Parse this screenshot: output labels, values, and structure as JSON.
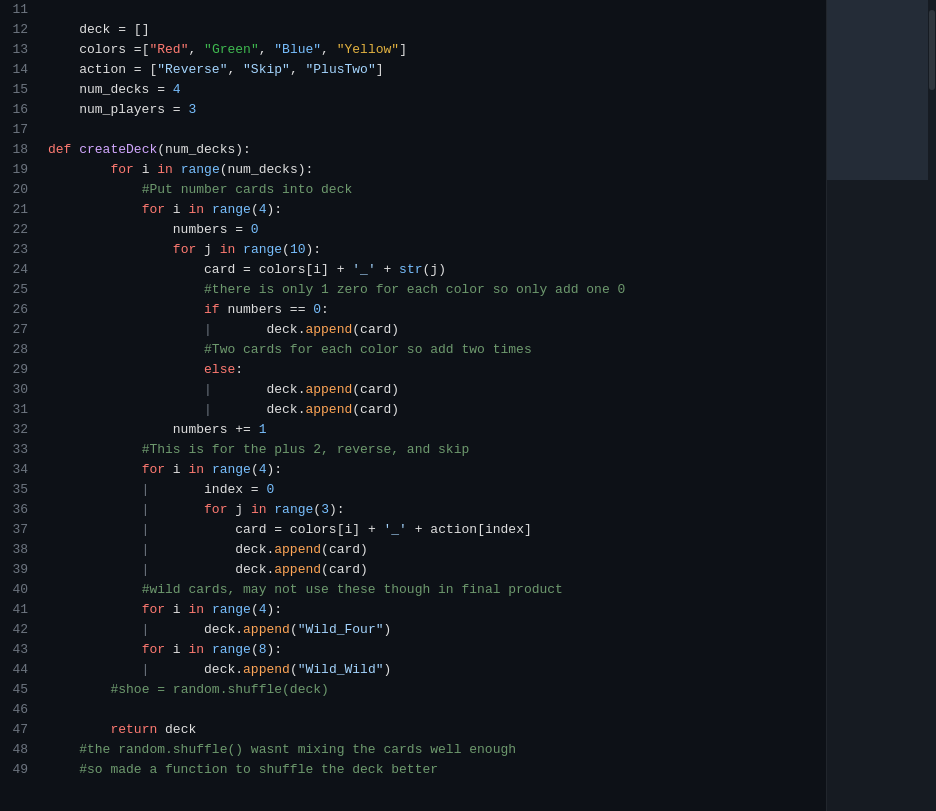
{
  "lines": [
    {
      "num": "11",
      "tokens": []
    },
    {
      "num": "12",
      "html": "<span class='va'>    deck</span><span class='op'> = </span><span class='bracket'>[]</span>"
    },
    {
      "num": "13",
      "html": "<span class='va'>    colors </span><span class='op'>=</span><span class='bracket'>[</span><span class='str-red'>\"Red\"</span><span class='op'>, </span><span class='str-green'>\"Green\"</span><span class='op'>, </span><span class='str-blue'>\"Blue\"</span><span class='op'>, </span><span class='str-yellow'>\"Yellow\"</span><span class='bracket'>]</span>"
    },
    {
      "num": "14",
      "html": "<span class='va'>    action</span><span class='op'> = </span><span class='bracket'>[</span><span class='st'>\"Reverse\"</span><span class='op'>, </span><span class='st'>\"Skip\"</span><span class='op'>, </span><span class='st'>\"PlusTwo\"</span><span class='bracket'>]</span>"
    },
    {
      "num": "15",
      "html": "<span class='va'>    num_decks</span><span class='op'> = </span><span class='nm'>4</span>"
    },
    {
      "num": "16",
      "html": "<span class='va'>    num_players</span><span class='op'> = </span><span class='nm'>3</span>"
    },
    {
      "num": "17",
      "html": ""
    },
    {
      "num": "18",
      "html": "<span class='kw'>def </span><span class='fn'>createDeck</span><span class='bracket'>(</span><span class='va'>num_decks</span><span class='bracket'>)</span><span class='op'>:</span>"
    },
    {
      "num": "19",
      "html": "<span class='va'>        </span><span class='kw'>for </span><span class='va'>i</span><span class='kw'> in </span><span class='bi'>range</span><span class='bracket'>(</span><span class='va'>num_decks</span><span class='bracket'>)</span><span class='op'>:</span>"
    },
    {
      "num": "20",
      "html": "<span class='va'>            </span><span class='cm'>#Put number cards into deck</span>"
    },
    {
      "num": "21",
      "html": "<span class='va'>            </span><span class='kw'>for </span><span class='va'>i</span><span class='kw'> in </span><span class='bi'>range</span><span class='bracket'>(</span><span class='nm'>4</span><span class='bracket'>)</span><span class='op'>:</span>"
    },
    {
      "num": "22",
      "html": "<span class='va'>                numbers</span><span class='op'> = </span><span class='nm'>0</span>"
    },
    {
      "num": "23",
      "html": "<span class='va'>                </span><span class='kw'>for </span><span class='va'>j</span><span class='kw'> in </span><span class='bi'>range</span><span class='bracket'>(</span><span class='nm'>10</span><span class='bracket'>)</span><span class='op'>:</span>"
    },
    {
      "num": "24",
      "html": "<span class='va'>                    card</span><span class='op'> = </span><span class='va'>colors</span><span class='bracket'>[</span><span class='va'>i</span><span class='bracket'>]</span><span class='op'> + </span><span class='st'>'_'</span><span class='op'> + </span><span class='bi'>str</span><span class='bracket'>(</span><span class='va'>j</span><span class='bracket'>)</span>"
    },
    {
      "num": "25",
      "html": "<span class='va'>                    </span><span class='cm'>#there is only 1 zero for each color so only add one 0</span>"
    },
    {
      "num": "26",
      "html": "<span class='va'>                    </span><span class='kw'>if </span><span class='va'>numbers</span><span class='op'> == </span><span class='nm'>0</span><span class='op'>:</span>"
    },
    {
      "num": "27",
      "html": "<span class='pipe-char'>                    |   </span><span class='va'>    deck</span><span class='op'>.</span><span class='at'>append</span><span class='bracket'>(</span><span class='va'>card</span><span class='bracket'>)</span>"
    },
    {
      "num": "28",
      "html": "<span class='va'>                    </span><span class='cm'>#Two cards for each color so add two times</span>"
    },
    {
      "num": "29",
      "html": "<span class='va'>                    </span><span class='kw'>else</span><span class='op'>:</span>"
    },
    {
      "num": "30",
      "html": "<span class='pipe-char'>                    |   </span><span class='va'>    deck</span><span class='op'>.</span><span class='at'>append</span><span class='bracket'>(</span><span class='va'>card</span><span class='bracket'>)</span>"
    },
    {
      "num": "31",
      "html": "<span class='pipe-char'>                    |   </span><span class='va'>    deck</span><span class='op'>.</span><span class='at'>append</span><span class='bracket'>(</span><span class='va'>card</span><span class='bracket'>)</span>"
    },
    {
      "num": "32",
      "html": "<span class='va'>                numbers</span><span class='op'> += </span><span class='nm'>1</span>"
    },
    {
      "num": "33",
      "html": "<span class='va'>            </span><span class='cm'>#This is for the plus 2, reverse, and skip</span>"
    },
    {
      "num": "34",
      "html": "<span class='va'>            </span><span class='kw'>for </span><span class='va'>i</span><span class='kw'> in </span><span class='bi'>range</span><span class='bracket'>(</span><span class='nm'>4</span><span class='bracket'>)</span><span class='op'>:</span>"
    },
    {
      "num": "35",
      "html": "<span class='pipe-char'>            |   </span><span class='va'>    index</span><span class='op'> = </span><span class='nm'>0</span>"
    },
    {
      "num": "36",
      "html": "<span class='pipe-char'>            |   </span><span class='va'>    </span><span class='kw'>for </span><span class='va'>j</span><span class='kw'> in </span><span class='bi'>range</span><span class='bracket'>(</span><span class='nm'>3</span><span class='bracket'>)</span><span class='op'>:</span>"
    },
    {
      "num": "37",
      "html": "<span class='pipe-char'>            |   </span><span class='va'>        card</span><span class='op'> = </span><span class='va'>colors</span><span class='bracket'>[</span><span class='va'>i</span><span class='bracket'>]</span><span class='op'> + </span><span class='st'>'_'</span><span class='op'> + </span><span class='va'>action</span><span class='bracket'>[</span><span class='va'>index</span><span class='bracket'>]</span>"
    },
    {
      "num": "38",
      "html": "<span class='pipe-char'>            |   </span><span class='va'>        deck</span><span class='op'>.</span><span class='at'>append</span><span class='bracket'>(</span><span class='va'>card</span><span class='bracket'>)</span>"
    },
    {
      "num": "39",
      "html": "<span class='pipe-char'>            |   </span><span class='va'>        deck</span><span class='op'>.</span><span class='at'>append</span><span class='bracket'>(</span><span class='va'>card</span><span class='bracket'>)</span>"
    },
    {
      "num": "40",
      "html": "<span class='va'>            </span><span class='cm'>#wild cards, may not use these though in final product</span>"
    },
    {
      "num": "41",
      "html": "<span class='va'>            </span><span class='kw'>for </span><span class='va'>i</span><span class='kw'> in </span><span class='bi'>range</span><span class='bracket'>(</span><span class='nm'>4</span><span class='bracket'>)</span><span class='op'>:</span>"
    },
    {
      "num": "42",
      "html": "<span class='pipe-char'>            |   </span><span class='va'>    deck</span><span class='op'>.</span><span class='at'>append</span><span class='bracket'>(</span><span class='st'>\"Wild_Four\"</span><span class='bracket'>)</span>"
    },
    {
      "num": "43",
      "html": "<span class='va'>            </span><span class='kw'>for </span><span class='va'>i</span><span class='kw'> in </span><span class='bi'>range</span><span class='bracket'>(</span><span class='nm'>8</span><span class='bracket'>)</span><span class='op'>:</span>"
    },
    {
      "num": "44",
      "html": "<span class='pipe-char'>            |   </span><span class='va'>    deck</span><span class='op'>.</span><span class='at'>append</span><span class='bracket'>(</span><span class='st'>\"Wild_Wild\"</span><span class='bracket'>)</span>"
    },
    {
      "num": "45",
      "html": "<span class='va'>        </span><span class='cm'>#shoe = random.shuffle(deck)</span>"
    },
    {
      "num": "46",
      "html": ""
    },
    {
      "num": "47",
      "html": "<span class='va'>        </span><span class='kw'>return </span><span class='va'>deck</span>"
    },
    {
      "num": "48",
      "html": "<span class='cm'>    #the random.shuffle() wasnt mixing the cards well enough</span>"
    },
    {
      "num": "49",
      "html": "<span class='cm'>    #so made a function to shuffle the deck better</span>"
    }
  ]
}
